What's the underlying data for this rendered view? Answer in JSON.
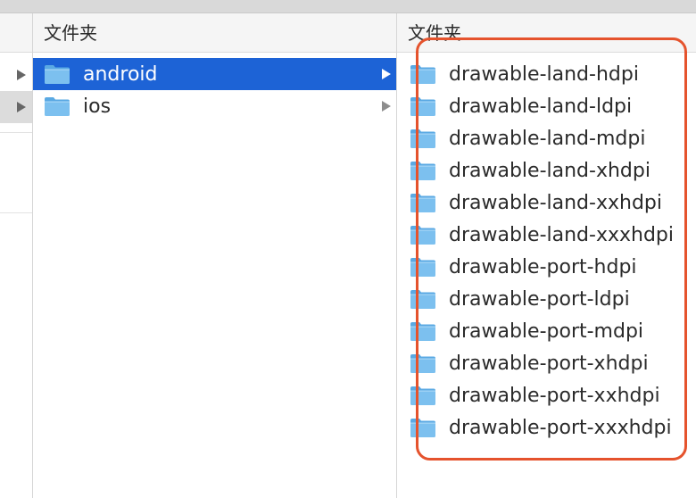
{
  "columns": {
    "col1": {
      "header": "文件夹"
    },
    "col2": {
      "header": "文件夹"
    }
  },
  "col1_items": [
    {
      "label": "android",
      "selected": true,
      "has_children": true
    },
    {
      "label": "ios",
      "selected": false,
      "has_children": true
    }
  ],
  "col2_items": [
    {
      "label": "drawable-land-hdpi"
    },
    {
      "label": "drawable-land-ldpi"
    },
    {
      "label": "drawable-land-mdpi"
    },
    {
      "label": "drawable-land-xhdpi"
    },
    {
      "label": "drawable-land-xxhdpi"
    },
    {
      "label": "drawable-land-xxxhdpi"
    },
    {
      "label": "drawable-port-hdpi"
    },
    {
      "label": "drawable-port-ldpi"
    },
    {
      "label": "drawable-port-mdpi"
    },
    {
      "label": "drawable-port-xhdpi"
    },
    {
      "label": "drawable-port-xxhdpi"
    },
    {
      "label": "drawable-port-xxxhdpi"
    }
  ],
  "colors": {
    "selection": "#1d63d6",
    "folder": "#7cc0ef",
    "annotation_box": "#e5532d"
  },
  "icons": {
    "folder": "folder-icon",
    "disclosure": "chevron-right-icon"
  }
}
